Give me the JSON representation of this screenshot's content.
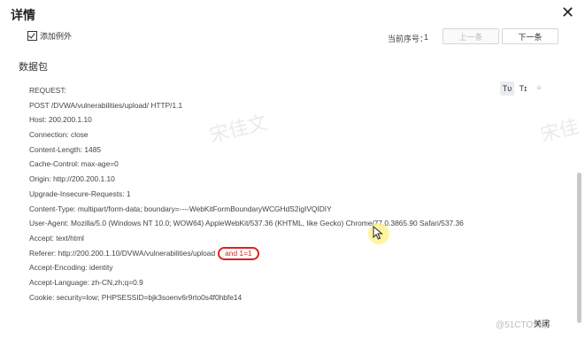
{
  "dialog": {
    "title": "详情",
    "close_glyph": "✕"
  },
  "toolbar": {
    "add_exception_label": "添加例外",
    "add_exception_checked": true,
    "seq_label": "当前序号：",
    "seq_value": "1",
    "prev_label": "上一条",
    "next_label": "下一条"
  },
  "section": {
    "title": "数据包"
  },
  "format_buttons": [
    {
      "label": "Tᴜ",
      "icon": "text-format-icon",
      "active": true
    },
    {
      "label": "Tɪ",
      "icon": "text-size-icon",
      "active": false
    },
    {
      "label": "⁘",
      "icon": "expand-icon",
      "active": false
    }
  ],
  "packet_lines": [
    "REQUEST:",
    "POST /DVWA/vulnerabilities/upload/ HTTP/1.1",
    "Host: 200.200.1.10",
    "Connection: close",
    "Content-Length: 1485",
    "Cache-Control: max-age=0",
    "Origin: http://200.200.1.10",
    "Upgrade-Insecure-Requests: 1",
    "Content-Type: multipart/form-data; boundary=----WebKitFormBoundaryWCGHdS2igIVQIDIY",
    "User-Agent: Mozilla/5.0 (Windows NT 10.0; WOW64) AppleWebKit/537.36 (KHTML, like Gecko) Chrome/77.0.3865.90 Safari/537.36",
    "Accept: text/html",
    "Referer: http://200.200.1.10/DVWA/vulnerabilities/upload",
    "Accept-Encoding: identity",
    "Accept-Language: zh-CN,zh;q=0.9",
    "Cookie: security=low; PHPSESSID=bjk3soenv6r9rto0s4f0hbfe14"
  ],
  "highlight": {
    "line_index": 11,
    "text": "and 1=1",
    "color": "#d9231f"
  },
  "watermark": {
    "text": "宋佳文",
    "text2": "宋佳"
  },
  "footer": {
    "close_label": "关闭",
    "watermark_text": "@51CTO博客"
  }
}
